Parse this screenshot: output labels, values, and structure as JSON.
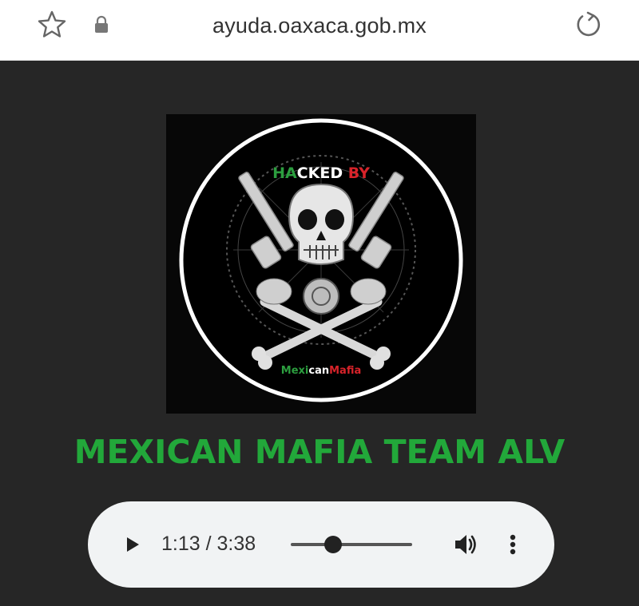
{
  "browser": {
    "url": "ayuda.oaxaca.gob.mx",
    "icons": {
      "bookmark": "star-icon",
      "secure": "lock-icon",
      "reload": "reload-icon"
    }
  },
  "emblem": {
    "top_text": [
      "HA",
      "CK",
      "ED",
      " BY"
    ],
    "bottom_text": [
      "Mexi",
      "can",
      "Mafia"
    ],
    "colors": {
      "green": "#2c9e3f",
      "white": "#ffffff",
      "red": "#d8232a"
    }
  },
  "page": {
    "headline": "MEXICAN MAFIA TEAM ALV",
    "headline_color": "#22a83a"
  },
  "audio_player": {
    "current_time": "1:13",
    "duration": "3:38",
    "time_display": "1:13 / 3:38",
    "progress": 0.35,
    "icons": {
      "play": "play-icon",
      "volume": "volume-icon",
      "menu": "more-vert-icon"
    }
  }
}
